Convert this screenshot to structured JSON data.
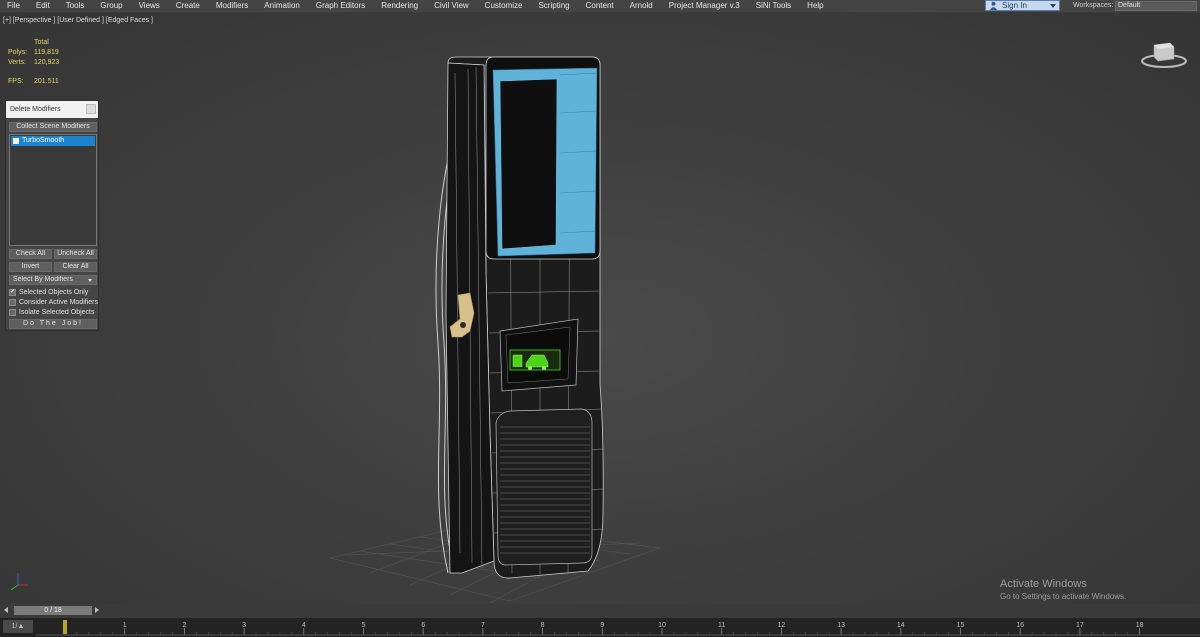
{
  "menu": {
    "items": [
      "File",
      "Edit",
      "Tools",
      "Group",
      "Views",
      "Create",
      "Modifiers",
      "Animation",
      "Graph Editors",
      "Rendering",
      "Civil View",
      "Customize",
      "Scripting",
      "Content",
      "Arnold",
      "Project Manager v.3",
      "SiNi Tools",
      "Help"
    ],
    "sign_in": "Sign In",
    "workspaces_label": "Workspaces:",
    "workspace_value": "Default"
  },
  "viewport": {
    "label": "[+] [Perspective ] [User Defined ] [Edged Faces ]",
    "stats": {
      "total_label": "Total",
      "polys_label": "Polys:",
      "polys_value": "119,819",
      "verts_label": "Verts:",
      "verts_value": "120,923",
      "fps_label": "FPS:",
      "fps_value": "201.511"
    },
    "activate_title": "Activate Windows",
    "activate_sub": "Go to Settings to activate Windows."
  },
  "panel": {
    "title": "Delete Modifiers",
    "collect_button": "Collect Scene Modifiers",
    "list_items": [
      {
        "label": "TurboSmooth",
        "selected": true
      }
    ],
    "check_all": "Check All",
    "uncheck_all": "Uncheck All",
    "invert": "Invert",
    "clear_all": "Clear All",
    "select_by": "Select By Modifiers",
    "options": [
      {
        "label": "Selected Objects Only",
        "checked": true
      },
      {
        "label": "Consider Active Modifiers",
        "checked": false
      },
      {
        "label": "Isolate Selected Objects",
        "checked": false
      }
    ],
    "do_job": "Do The Job!"
  },
  "timeline": {
    "frame_display": "0 / 18",
    "track_button": "1/▲",
    "ticks": [
      "1",
      "2",
      "3",
      "4",
      "5",
      "6",
      "7",
      "8",
      "9",
      "10",
      "11",
      "12",
      "13",
      "14",
      "15",
      "16",
      "17",
      "18"
    ]
  },
  "colors": {
    "selection_blue": "#1b84cf",
    "stats_yellow": "#e8d35c",
    "screen_cyan": "#5fb3d8",
    "lcd_green": "#4cd419",
    "nozzle_tan": "#d8c08a"
  },
  "icons": {
    "sign_in": "user-icon",
    "viewcube": "viewcube-icon",
    "axis": "axis-tripod-icon"
  }
}
